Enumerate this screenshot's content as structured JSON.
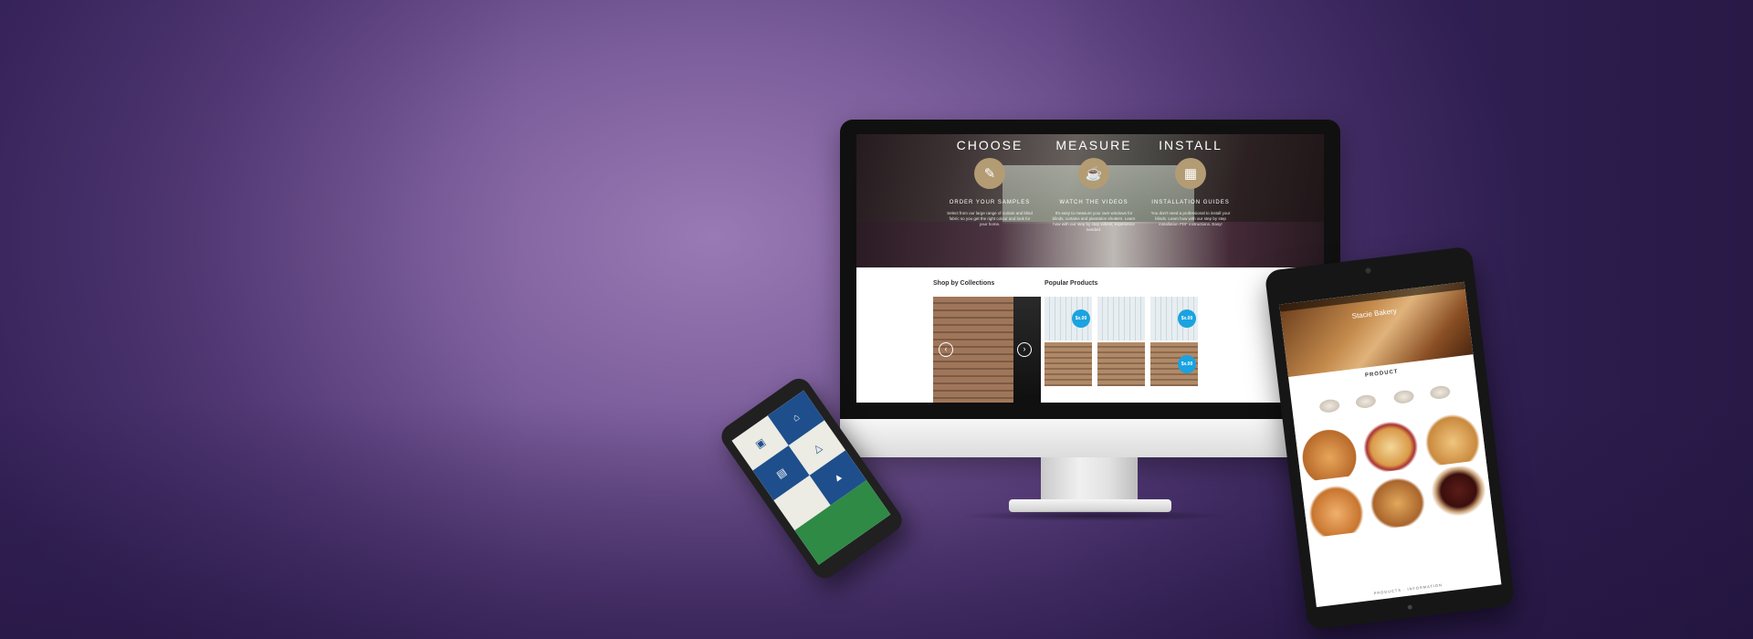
{
  "monitor": {
    "steps": [
      {
        "title": "CHOOSE",
        "subtitle": "ORDER YOUR SAMPLES",
        "icon": "swatch-icon",
        "desc": "Select from our large range of curtain and blind fabric so you get the right colour and look for your home."
      },
      {
        "title": "MEASURE",
        "subtitle": "WATCH THE VIDEOS",
        "icon": "measuring-cup-icon",
        "desc": "It's easy to measure your own windows for blinds, curtains and plantation shutters. Learn how with our step by step videos, experience needed."
      },
      {
        "title": "INSTALL",
        "subtitle": "INSTALLATION GUIDES",
        "icon": "window-icon",
        "desc": "You don't need a professional to install your blinds. Learn how with our step by step installation PDF instructions. Easy!"
      }
    ],
    "shop_by_collections": "Shop by Collections",
    "popular_products": "Popular Products",
    "prices": [
      "$x.00",
      "$x.00",
      "$x.00",
      "$x.00"
    ],
    "prev_glyph": "‹",
    "next_glyph": "›"
  },
  "tablet": {
    "brand": "Stacie Bakery",
    "section_title": "PRODUCT",
    "footer": "PRODUCTS · INFORMATION"
  },
  "colors": {
    "accent_gold": "#b39c73",
    "price_blue": "#1aa3e0",
    "phone_blue": "#1e4f8c",
    "phone_green": "#2e8a45"
  }
}
